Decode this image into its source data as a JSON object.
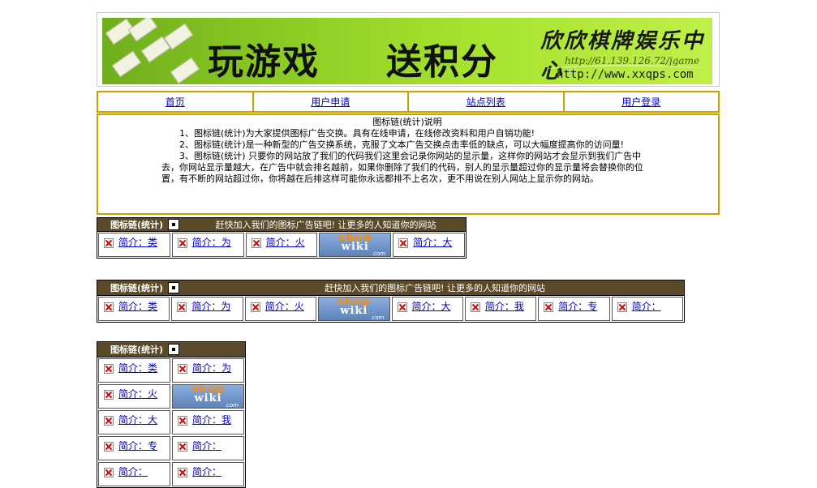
{
  "banner": {
    "slogan_left": "玩游戏",
    "slogan_right": "送积分",
    "brand": "欣欣棋牌娱乐中心",
    "ip_text": "http://61.139.126.72/jgame",
    "url_text": "http://www.xxqps.com"
  },
  "nav": {
    "items": [
      "首页",
      "用户申请",
      "站点列表",
      "用户登录"
    ],
    "border_color": "#c8a000"
  },
  "description": {
    "title": "图标链(统计)说明",
    "paragraphs": [
      "1、图标链(统计)为大家提供图标广告交换。具有在线申请，在线修改资料和用户自销功能!",
      "2、图标链(统计)是一种新型的广告交换系统，克服了文本广告交换点击率低的缺点，可以大幅度提高你的访问量!",
      "3、图标链(统计) 只要你的网站放了我们的代码我们这里会记录你网站的显示量，这样你的网站才会显示到我们广告中去，你网站显示量越大，在广告中就会排名越前，如果你删除了我们的代码，别人的显示量超过你的显示量将会替换你的位置，有不断的网站超过你，你将越在后排这样可能你永远都排不上名次，更不用说在别人网站上显示你的网站。"
    ]
  },
  "widget": {
    "name": "图标链(统计)",
    "promo": "赶快加入我们的图标广告链吧! 让更多的人知道你的网站",
    "header_color": "#5a4a2a",
    "shop_logo": {
      "line1": "shop",
      "line2": "wiki",
      "line3": ".com"
    }
  },
  "ads": {
    "small": [
      "简介：类",
      "简介：为",
      "简介：火",
      "SHOP",
      "简介：大"
    ],
    "wide": [
      "简介：类",
      "简介：为",
      "简介：火",
      "SHOP",
      "简介：大",
      "简介：我",
      "简介：专",
      "简介："
    ],
    "vertical": [
      "简介：类",
      "简介：为",
      "简介：火",
      "SHOP",
      "简介：大",
      "简介：我",
      "简介：专",
      "简介：",
      "简介：",
      "简介："
    ]
  }
}
